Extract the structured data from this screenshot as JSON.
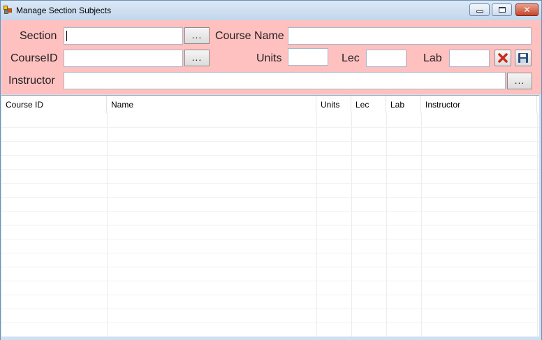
{
  "window": {
    "title": "Manage Section Subjects",
    "close_glyph": "✕"
  },
  "form": {
    "section_label": "Section",
    "course_name_label": "Course Name",
    "course_id_label": "CourseID",
    "units_label": "Units",
    "lec_label": "Lec",
    "lab_label": "Lab",
    "instructor_label": "Instructor",
    "browse_label": "...",
    "section_value": "",
    "course_name_value": "",
    "course_id_value": "",
    "units_value": "",
    "lec_value": "",
    "lab_value": "",
    "instructor_value": ""
  },
  "table": {
    "columns": [
      "Course ID",
      "Name",
      "Units",
      "Lec",
      "Lab",
      "Instructor"
    ],
    "rows": []
  },
  "colors": {
    "form_background": "#ffc0c0",
    "titlebar": "#cfe0f3",
    "delete_icon": "#cc2a1e",
    "save_icon": "#2d4f7c"
  },
  "icons": [
    "app-icon",
    "minimize-icon",
    "maximize-icon",
    "close-icon",
    "delete-icon",
    "save-icon"
  ]
}
